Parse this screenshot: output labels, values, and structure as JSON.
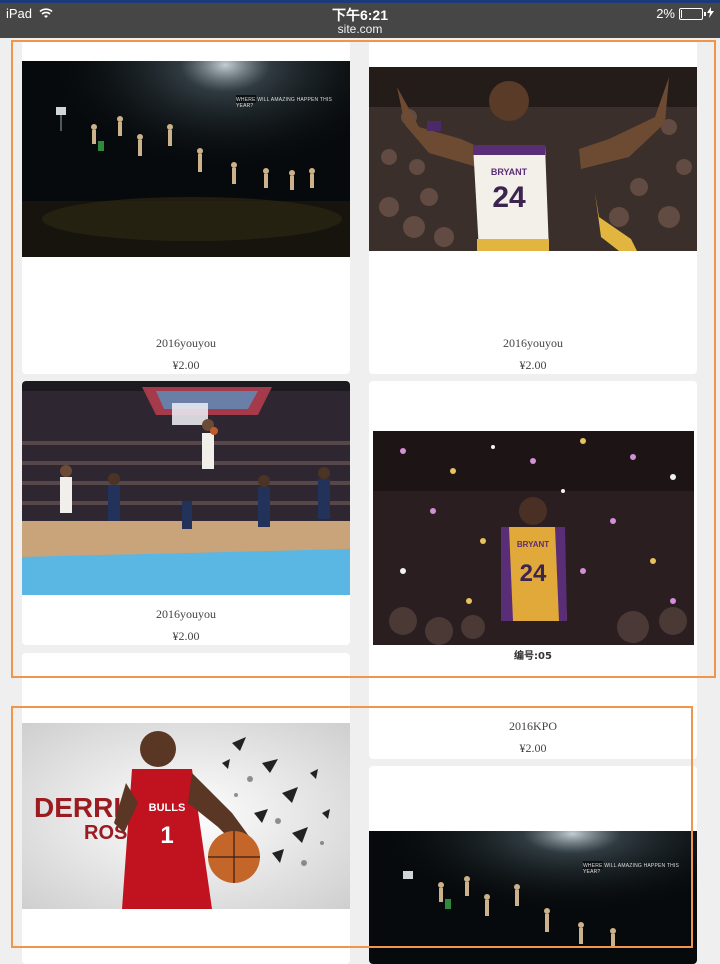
{
  "status_bar": {
    "device": "iPad",
    "time": "下午6:21",
    "url": "site.com",
    "battery": "2%"
  },
  "products": [
    {
      "name": "2016youyou",
      "price": "¥2.00",
      "image": "nba-finals-night-poster"
    },
    {
      "name": "2016youyou",
      "price": "¥2.00",
      "image": "kobe-24-arms-raised"
    },
    {
      "name": "2016youyou",
      "price": "¥2.00",
      "image": "rose-layup-arena"
    },
    {
      "name": "2016KPO",
      "price": "¥2.00",
      "image": "kobe-24-confetti",
      "image_caption": "编号:05"
    },
    {
      "image": "derrick-rose-bulls-art",
      "poster_text": [
        "DERRICK",
        "ROSE"
      ],
      "jersey_text": "BULLS"
    },
    {
      "image": "nba-finals-night-poster"
    }
  ],
  "poster_tagline": "WHERE WILL AMAZING HAPPEN THIS YEAR?",
  "jersey": {
    "name": "BRYANT",
    "number": "24"
  },
  "rose_number": "1",
  "colors": {
    "highlight_border": "#f0954a",
    "page_background": "#efefef",
    "status_bar": "#464646"
  }
}
